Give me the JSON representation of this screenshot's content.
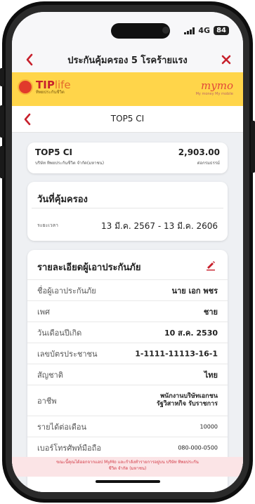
{
  "status_bar": {
    "network": "4G",
    "battery": "84"
  },
  "header": {
    "title": "ประกันคุ้มครอง 5 โรคร้ายแรง"
  },
  "brand": {
    "tip_name": "TIP",
    "tip_name_suffix": "life",
    "tip_subtitle": "ทิพยประกันชีวิต",
    "mymo_name": "mymo",
    "mymo_subtitle": "My money My mobile"
  },
  "sub_header": {
    "title": "TOP5 CI"
  },
  "product": {
    "name": "TOP5 CI",
    "company": "บริษัท ทิพยประกันชีวิต จำกัด(มหาชน)",
    "price": "2,903.00",
    "unit": "ต่อกรมธรรม์"
  },
  "coverage": {
    "title": "วันที่คุ้มครอง",
    "label": "ระยะเวลา",
    "value": "13 มี.ค. 2567 - 13 มี.ค. 2606"
  },
  "insured": {
    "title": "รายละเอียดผู้เอาประกันภัย",
    "rows": [
      {
        "label": "ชื่อผู้เอาประกันภัย",
        "value": "นาย เอก พชร"
      },
      {
        "label": "เพศ",
        "value": "ชาย"
      },
      {
        "label": "วันเดือนปีเกิด",
        "value": "10 ส.ค. 2530"
      },
      {
        "label": "เลขบัตรประชาชน",
        "value": "1-1111-11113-16-1"
      },
      {
        "label": "สัญชาติ",
        "value": "ไทย"
      },
      {
        "label": "อาชีพ",
        "value_line1": "พนักงานบริษัทเอกชน",
        "value_line2": "รัฐวิสาหกิจ รับราชการ"
      },
      {
        "label": "รายได้ต่อเดือน",
        "value": "10000"
      },
      {
        "label": "เบอร์โทรศัพท์มือถือ",
        "value": "080-000-0500"
      }
    ]
  },
  "notice": {
    "line1": "ขณะนี้คุณได้ออกจากแอป MyMo และกำลังทำรายการอยู่บน บริษัท ทิพยประกัน",
    "line2": "ชีวิต จำกัด (มหาชน)"
  },
  "colors": {
    "brand_red": "#c7202c",
    "banner_yellow": "#ffd54a",
    "notice_bg": "#fbe4e6"
  },
  "icons": [
    "back-chevron-icon",
    "close-icon",
    "edit-pencil-icon",
    "signal-icon",
    "battery-icon"
  ]
}
